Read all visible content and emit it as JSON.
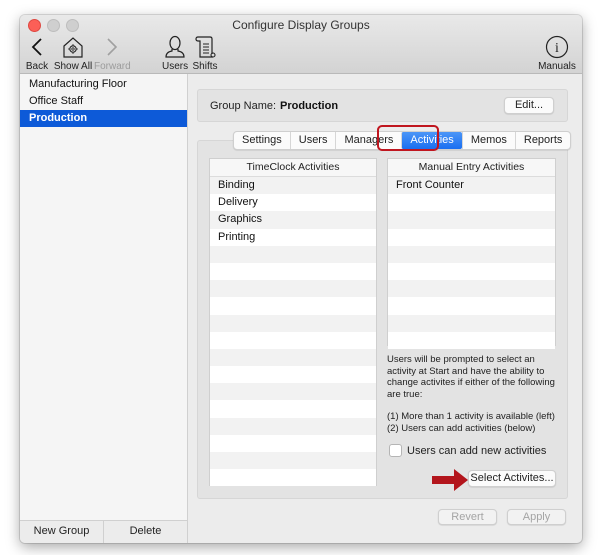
{
  "window": {
    "title": "Configure Display Groups"
  },
  "toolbar": {
    "items": [
      {
        "label": "Back",
        "icon": "chevron-left-icon",
        "enabled": true
      },
      {
        "label": "Show All",
        "icon": "house-gear-icon",
        "enabled": true
      },
      {
        "label": "Forward",
        "icon": "chevron-right-icon",
        "enabled": false
      },
      {
        "label": "Users",
        "icon": "user-icon",
        "enabled": true
      },
      {
        "label": "Shifts",
        "icon": "scroll-icon",
        "enabled": true
      },
      {
        "label": "Manuals",
        "icon": "info-circle-icon",
        "enabled": true
      }
    ]
  },
  "sidebar": {
    "groups": [
      {
        "label": "Manufacturing Floor",
        "selected": false
      },
      {
        "label": "Office Staff",
        "selected": false
      },
      {
        "label": "Production",
        "selected": true
      }
    ],
    "new_group_label": "New Group",
    "delete_label": "Delete"
  },
  "group": {
    "name_label": "Group Name:",
    "name_value": "Production",
    "edit_label": "Edit..."
  },
  "tabs": [
    {
      "label": "Settings",
      "active": false
    },
    {
      "label": "Users",
      "active": false
    },
    {
      "label": "Managers",
      "active": false
    },
    {
      "label": "Activities",
      "active": true
    },
    {
      "label": "Memos",
      "active": false
    },
    {
      "label": "Reports",
      "active": false
    }
  ],
  "timeclock": {
    "header": "TimeClock Activities",
    "rows": [
      "Binding",
      "Delivery",
      "Graphics",
      "Printing"
    ]
  },
  "manual_entry": {
    "header": "Manual Entry Activities",
    "rows": [
      "Front Counter"
    ]
  },
  "info": {
    "paragraph1": "Users will be prompted to select an activity at Start and have the ability to change activites if either of the following are true:",
    "line1": "(1) More than 1 activity is available (left)",
    "line2": "(2) Users can add activities (below)"
  },
  "options": {
    "users_can_add_label": "Users can add new activities",
    "users_can_add_checked": false,
    "select_activities_label": "Select Activites..."
  },
  "footer": {
    "revert_label": "Revert",
    "apply_label": "Apply"
  },
  "colors": {
    "selection": "#0d5ad8",
    "annotation_red": "#c0161f"
  }
}
